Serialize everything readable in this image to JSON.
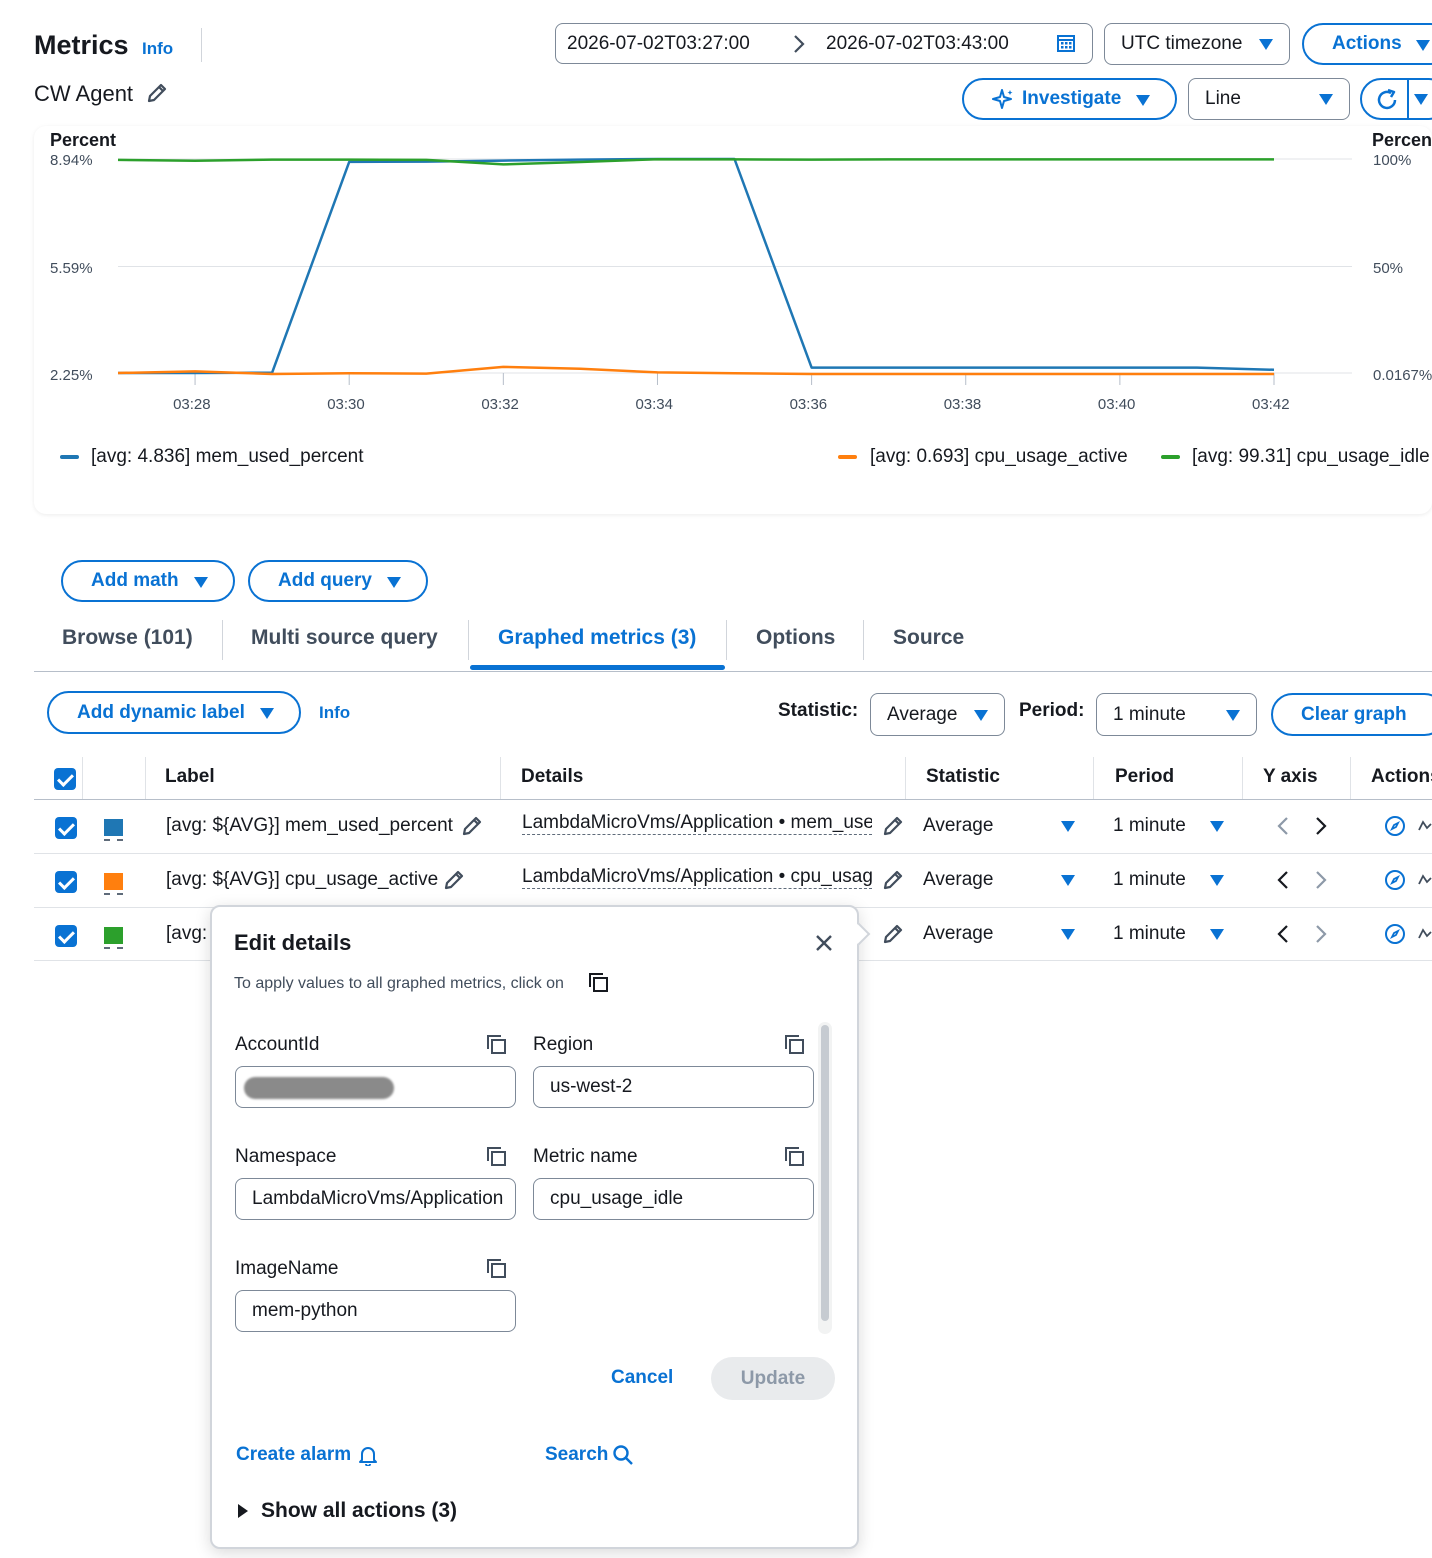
{
  "header": {
    "title": "Metrics",
    "info": "Info",
    "subtitle": "CW Agent",
    "time_start": "2026-07-02T03:27:00",
    "time_end": "2026-07-02T03:43:00",
    "timezone": "UTC timezone",
    "actions": "Actions",
    "investigate": "Investigate",
    "chart_type": "Line"
  },
  "chart_data": {
    "type": "line",
    "left_axis_label": "Percent",
    "right_axis_label": "Percen",
    "left_ticks": [
      "8.94%",
      "5.59%",
      "2.25%"
    ],
    "right_ticks": [
      "100%",
      "50%",
      "0.0167%"
    ],
    "x_ticks": [
      "03:28",
      "03:30",
      "03:32",
      "03:34",
      "03:36",
      "03:38",
      "03:40",
      "03:42"
    ],
    "x_minutes": [
      27,
      27.5,
      28,
      28.5,
      29,
      29.5,
      30,
      30.5,
      31,
      31.5,
      32,
      32.5,
      33,
      33.5,
      34,
      34.5,
      35,
      35.5,
      36,
      36.5,
      37,
      37.5,
      38,
      38.5,
      39,
      39.5,
      40,
      40.5,
      41,
      41.5,
      42
    ],
    "x_domain": [
      27,
      42.5
    ],
    "series": [
      {
        "name": "[avg: 4.836] mem_used_percent",
        "color": "#1f77b4",
        "axis": "left",
        "ylim": [
          2.25,
          8.94
        ],
        "x": [
          27,
          28,
          29,
          30,
          31,
          32,
          33,
          34,
          35,
          36,
          37,
          38,
          39,
          40,
          41,
          42
        ],
        "values": [
          2.25,
          2.25,
          2.26,
          8.85,
          8.86,
          8.89,
          8.92,
          8.94,
          8.94,
          2.42,
          2.42,
          2.42,
          2.42,
          2.42,
          2.42,
          2.35
        ]
      },
      {
        "name": "[avg: 0.693] cpu_usage_active",
        "color": "#ff7f0e",
        "axis": "left",
        "ylim": [
          2.25,
          8.94
        ],
        "x": [
          27,
          28,
          29,
          30,
          31,
          32,
          33,
          34,
          35,
          36,
          37,
          38,
          39,
          40,
          41,
          42
        ],
        "values": [
          2.25,
          2.3,
          2.22,
          2.24,
          2.23,
          2.44,
          2.38,
          2.27,
          2.24,
          2.22,
          2.22,
          2.22,
          2.22,
          2.22,
          2.22,
          2.22
        ]
      },
      {
        "name": "[avg: 99.31] cpu_usage_idle",
        "color": "#2ca02c",
        "axis": "right",
        "ylim": [
          0.0167,
          100
        ],
        "x": [
          27,
          28,
          29,
          30,
          31,
          32,
          33,
          34,
          35,
          36,
          37,
          38,
          39,
          40,
          41,
          42
        ],
        "values": [
          99.6,
          99.2,
          99.7,
          99.7,
          99.6,
          97.5,
          98.6,
          99.9,
          99.8,
          99.7,
          99.8,
          99.8,
          99.8,
          99.8,
          99.8,
          99.8
        ]
      }
    ]
  },
  "panel": {
    "add_math": "Add math",
    "add_query": "Add query",
    "tabs": [
      "Browse (101)",
      "Multi source query",
      "Graphed metrics (3)",
      "Options",
      "Source"
    ],
    "add_dynamic_label": "Add dynamic label",
    "info": "Info",
    "statistic_label": "Statistic:",
    "statistic_value": "Average",
    "period_label": "Period:",
    "period_value": "1 minute",
    "clear_graph": "Clear graph"
  },
  "table": {
    "headers": [
      "Label",
      "Details",
      "Statistic",
      "Period",
      "Y axis",
      "Actions"
    ],
    "rows": [
      {
        "label": "[avg: ${AVG}] mem_used_percent",
        "details": "LambdaMicroVms/Application • mem_used_percent",
        "statistic": "Average",
        "period": "1 minute",
        "color": "#1f77b4"
      },
      {
        "label": "[avg: ${AVG}] cpu_usage_active",
        "details": "LambdaMicroVms/Application • cpu_usage_active",
        "statistic": "Average",
        "period": "1 minute",
        "color": "#ff7f0e"
      },
      {
        "label": "[avg:",
        "details": "",
        "statistic": "Average",
        "period": "1 minute",
        "color": "#2ca02c"
      }
    ]
  },
  "popover": {
    "title": "Edit details",
    "hint": "To apply values to all graphed metrics, click on",
    "fields": {
      "account_id": {
        "label": "AccountId",
        "value": ""
      },
      "region": {
        "label": "Region",
        "value": "us-west-2"
      },
      "namespace": {
        "label": "Namespace",
        "value": "LambdaMicroVms/Application"
      },
      "metric_name": {
        "label": "Metric name",
        "value": "cpu_usage_idle"
      },
      "image_name": {
        "label": "ImageName",
        "value": "mem-python"
      }
    },
    "cancel": "Cancel",
    "update": "Update",
    "create_alarm": "Create alarm",
    "search": "Search",
    "show_all_actions": "Show all actions (3)"
  }
}
